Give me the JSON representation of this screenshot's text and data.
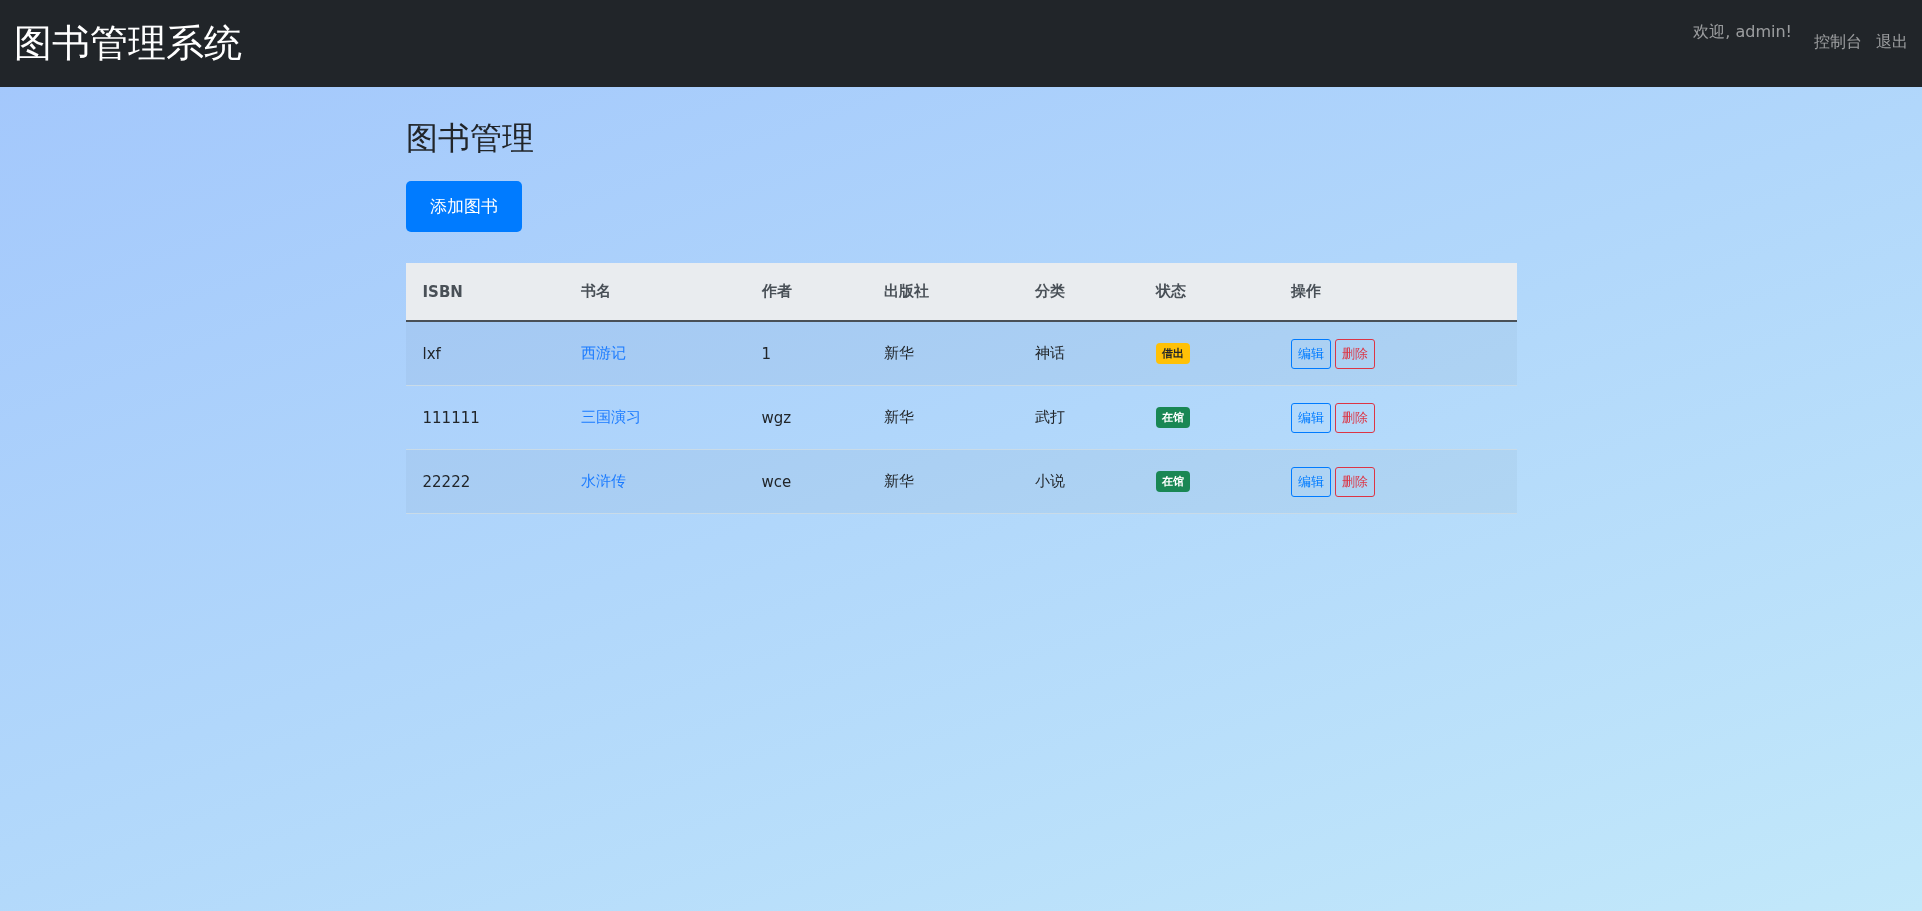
{
  "navbar": {
    "brand": "图书管理系统",
    "welcome": "欢迎, admin!",
    "links": [
      "控制台",
      "退出"
    ]
  },
  "page": {
    "title": "图书管理",
    "add_button": "添加图书"
  },
  "table": {
    "columns": [
      "ISBN",
      "书名",
      "作者",
      "出版社",
      "分类",
      "状态",
      "操作"
    ],
    "rows": [
      {
        "isbn": "lxf",
        "title": "西游记",
        "author": "1",
        "publisher": "新华",
        "category": "神话",
        "status": {
          "label": "借出",
          "kind": "lent"
        },
        "actions": [
          "编辑",
          "删除"
        ]
      },
      {
        "isbn": "111111",
        "title": "三国演习",
        "author": "wgz",
        "publisher": "新华",
        "category": "武打",
        "status": {
          "label": "在馆",
          "kind": "available"
        },
        "actions": [
          "编辑",
          "删除"
        ]
      },
      {
        "isbn": "22222",
        "title": "水浒传",
        "author": "wce",
        "publisher": "新华",
        "category": "小说",
        "status": {
          "label": "在馆",
          "kind": "available"
        },
        "actions": [
          "编辑",
          "删除"
        ]
      }
    ]
  }
}
